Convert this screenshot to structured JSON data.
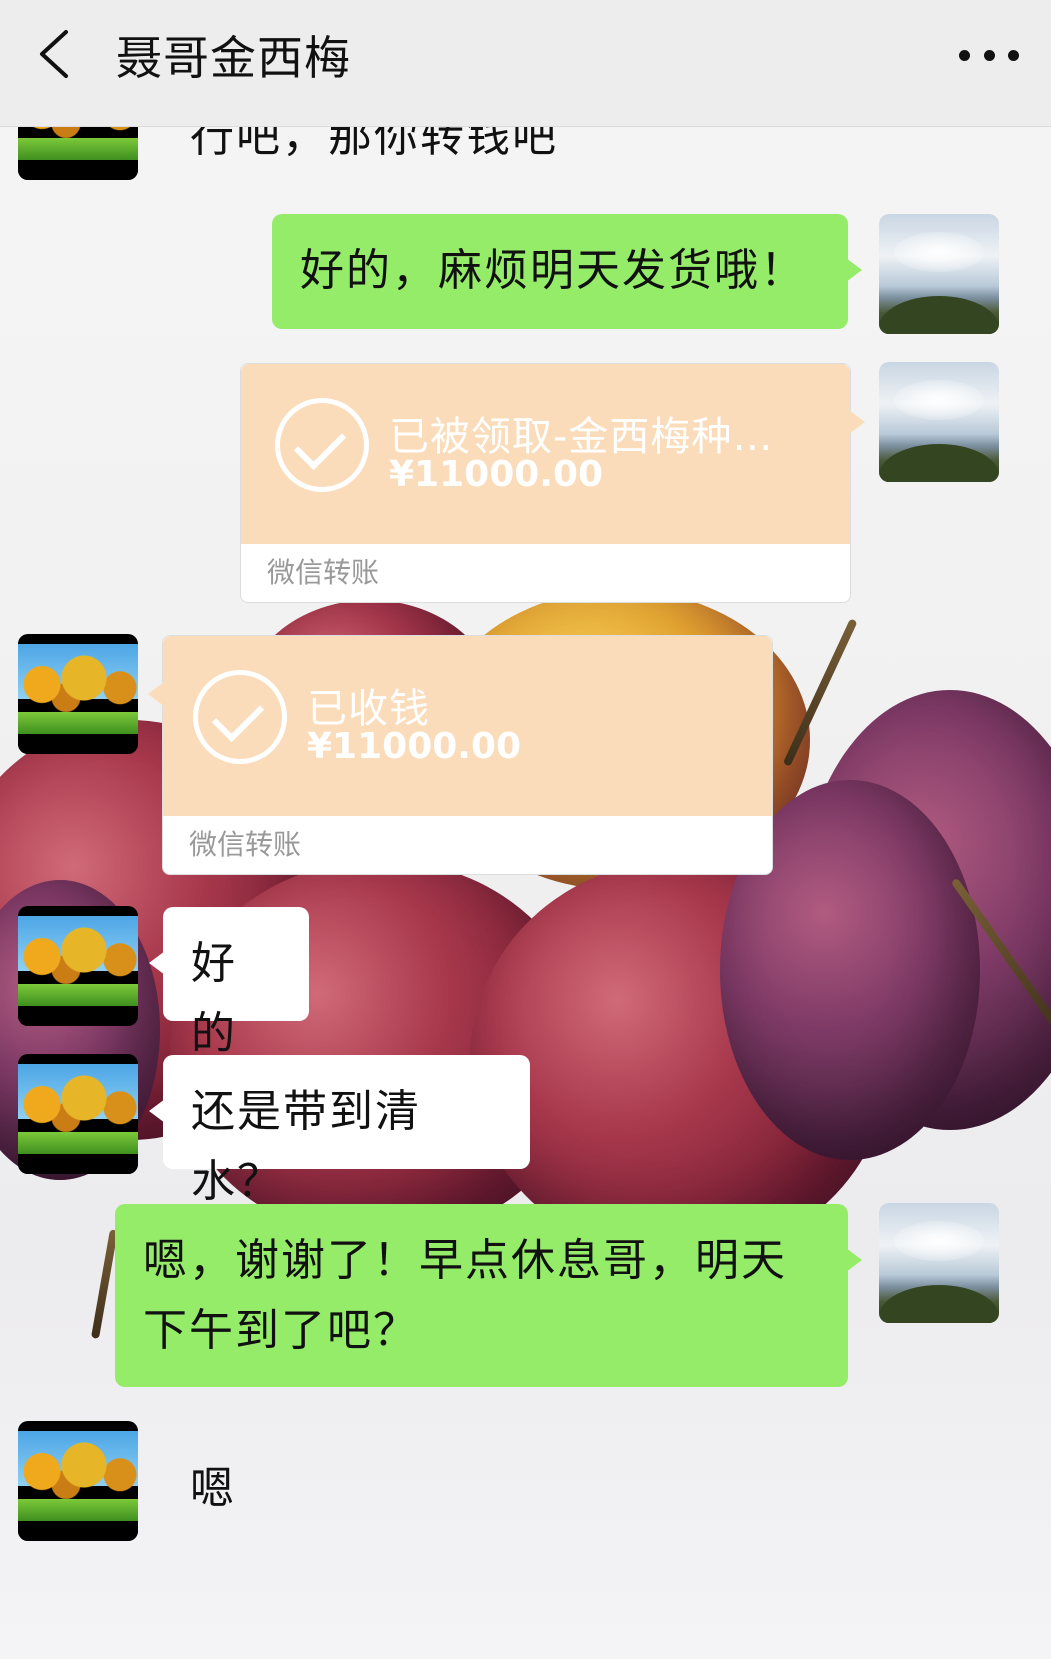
{
  "header": {
    "title": "聂哥金西梅",
    "back_icon": "chevron-left-icon",
    "more_icon": "more-dots-icon"
  },
  "messages": [
    {
      "sender": "contact",
      "type": "text",
      "text": "行吧，那你转钱吧"
    },
    {
      "sender": "me",
      "type": "text",
      "text": "好的，麻烦明天发货哦！"
    },
    {
      "sender": "me",
      "type": "transfer",
      "title": "已被领取-金西梅种…",
      "amount": "¥11000.00",
      "label": "微信转账"
    },
    {
      "sender": "contact",
      "type": "transfer",
      "title": "已收钱",
      "amount": "¥11000.00",
      "label": "微信转账"
    },
    {
      "sender": "contact",
      "type": "text",
      "text": "好的"
    },
    {
      "sender": "contact",
      "type": "text",
      "text": "还是带到清水？"
    },
    {
      "sender": "me",
      "type": "text",
      "text": "嗯，谢谢了！早点休息哥，明天下午到了吧？"
    },
    {
      "sender": "contact",
      "type": "text",
      "text": "嗯"
    }
  ],
  "colors": {
    "my_bubble": "#95ec69",
    "their_bubble": "#ffffff",
    "transfer_card": "#fbdcba",
    "header_bg": "#ededed"
  }
}
